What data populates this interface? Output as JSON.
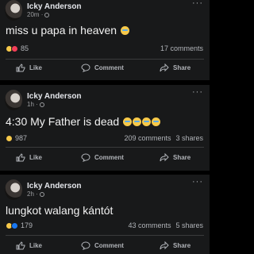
{
  "posts": [
    {
      "author": "Icky Anderson",
      "time": "20m · ",
      "text": "miss u papa in heaven",
      "emoji": [
        "crying-face"
      ],
      "reactions": [
        "sad",
        "love"
      ],
      "reaction_count": "85",
      "comments": "17 comments",
      "shares": "",
      "actions": {
        "like": "Like",
        "comment": "Comment",
        "share": "Share"
      }
    },
    {
      "author": "Icky Anderson",
      "time": "1h · ",
      "text": "4:30 My Father is dead",
      "emoji": [
        "crying-face",
        "crying-face",
        "crying-face",
        "crying-face"
      ],
      "reactions": [
        "sad"
      ],
      "reaction_count": "987",
      "comments": "209 comments",
      "shares": "3 shares",
      "actions": {
        "like": "Like",
        "comment": "Comment",
        "share": "Share"
      }
    },
    {
      "author": "Icky Anderson",
      "time": "2h · ",
      "text": "lungkot walang kántót",
      "emoji": [],
      "reactions": [
        "haha",
        "like"
      ],
      "reaction_count": "179",
      "comments": "43 comments",
      "shares": "5 shares",
      "actions": {
        "like": "Like",
        "comment": "Comment",
        "share": "Share"
      }
    }
  ],
  "more_glyph": "···"
}
